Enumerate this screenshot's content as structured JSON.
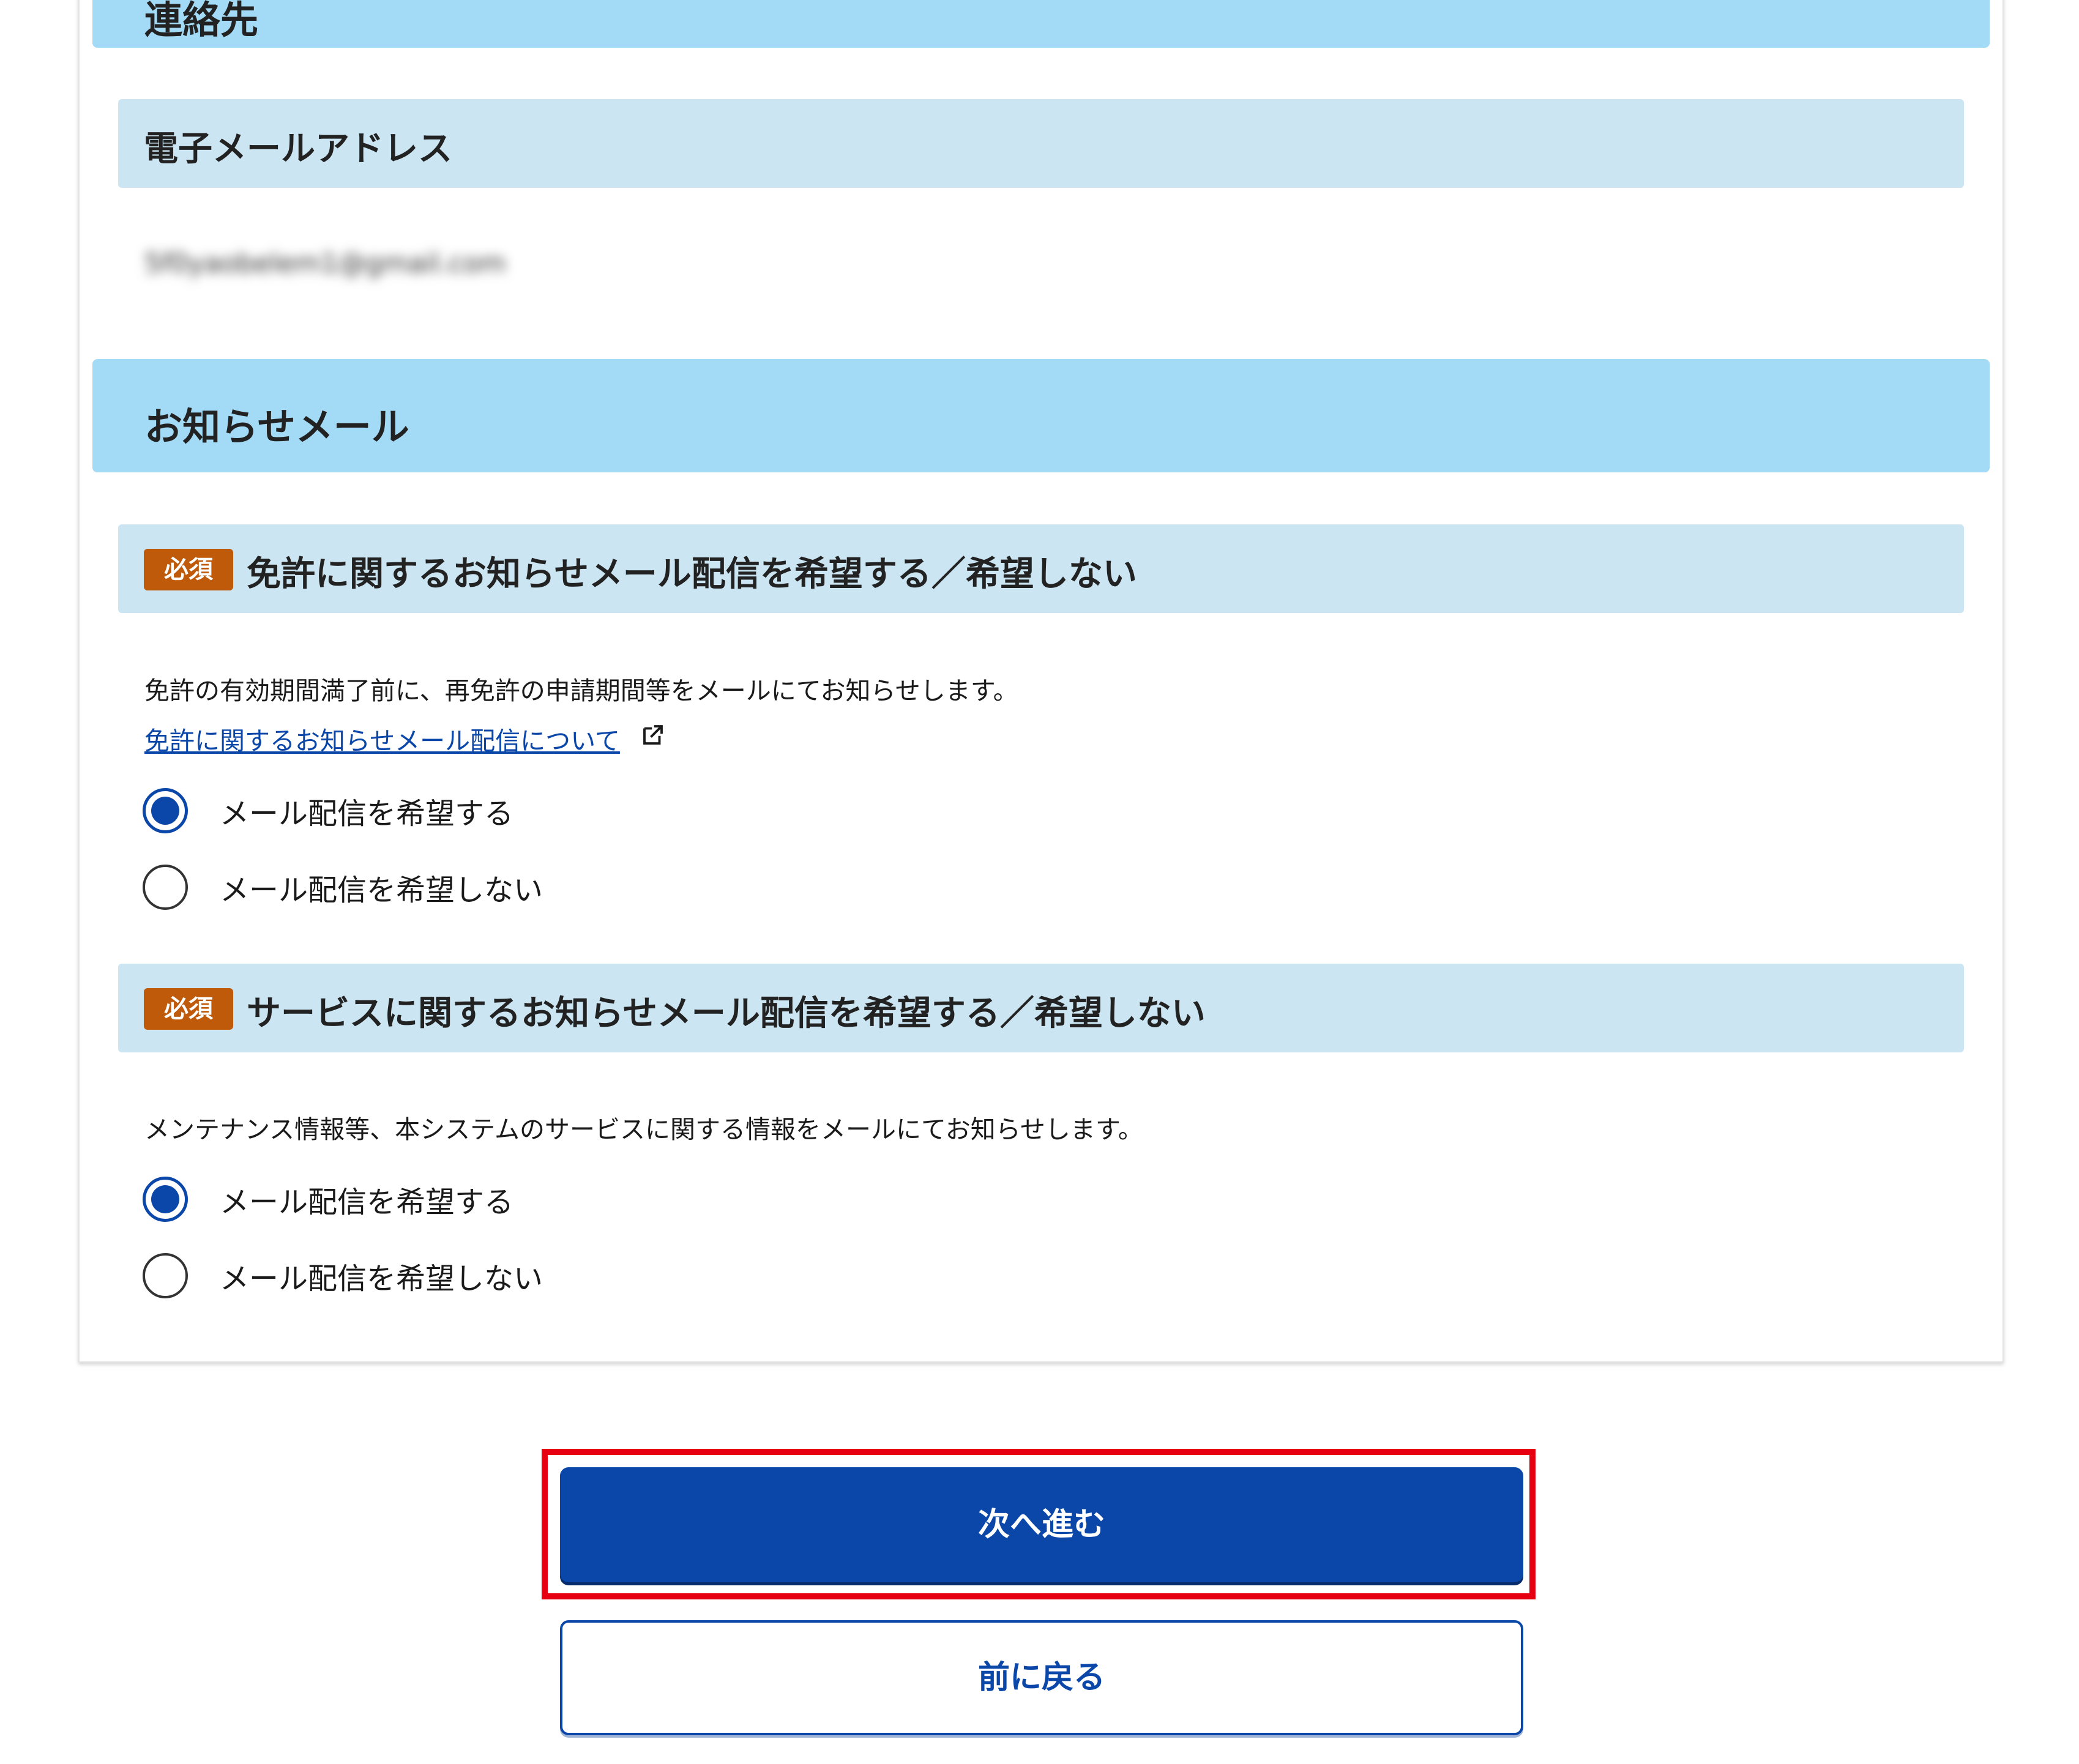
{
  "contact_section": {
    "title": "連絡先"
  },
  "email_field": {
    "label": "電子メールアドレス",
    "value": "5f0yaobelem1@gmail.com"
  },
  "notification_section": {
    "title": "お知らせメール"
  },
  "license_mail": {
    "required_badge": "必須",
    "title": "免許に関するお知らせメール配信を希望する／希望しない",
    "description": "免許の有効期間満了前に、再免許の申請期間等をメールにてお知らせします。",
    "link_text": "免許に関するお知らせメール配信について",
    "options": [
      {
        "label": "メール配信を希望する",
        "checked": true
      },
      {
        "label": "メール配信を希望しない",
        "checked": false
      }
    ]
  },
  "service_mail": {
    "required_badge": "必須",
    "title": "サービスに関するお知らせメール配信を希望する／希望しない",
    "description": "メンテナンス情報等、本システムのサービスに関する情報をメールにてお知らせします。",
    "options": [
      {
        "label": "メール配信を希望する",
        "checked": true
      },
      {
        "label": "メール配信を希望しない",
        "checked": false
      }
    ]
  },
  "buttons": {
    "next_label": "次へ進む",
    "back_label": "前に戻る"
  },
  "colors": {
    "primary": "#0b47a8",
    "section_header_bg": "#a3daf5",
    "sub_header_bg": "#cbe5f2",
    "required_badge_bg": "#bf5a0a",
    "highlight_border": "#e60012"
  }
}
